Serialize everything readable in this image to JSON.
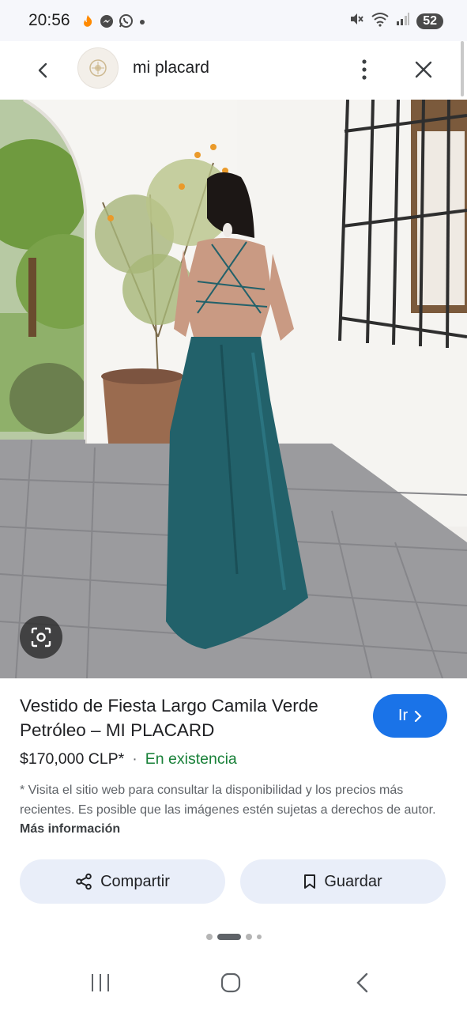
{
  "status_bar": {
    "time": "20:56",
    "battery": "52",
    "left_icons": [
      "fire-icon",
      "messenger-icon",
      "whatsapp-icon",
      "dot-icon"
    ],
    "right_icons": [
      "mute-icon",
      "wifi-icon",
      "signal-icon"
    ]
  },
  "header": {
    "site_name": "mi placard",
    "icons": [
      "back-arrow-icon",
      "site-logo",
      "more-vert-icon",
      "close-icon"
    ]
  },
  "product": {
    "title": "Vestido de Fiesta Largo Camila Verde Petróleo – MI PLACARD",
    "price": "$170,000 CLP*",
    "separator": "·",
    "stock": "En existencia",
    "disclaimer": "* Visita el sitio web para consultar la disponibilidad y los precios más recientes. Es posible que las imágenes estén sujetas a derechos de autor.",
    "more_info": "Más información"
  },
  "buttons": {
    "go": "Ir",
    "share": "Compartir",
    "save": "Guardar"
  },
  "colors": {
    "accent": "#1a73e8",
    "stock_green": "#188038",
    "pill_bg": "#e9eef9",
    "dress_teal": "#22616a"
  },
  "pager": {
    "count": 5,
    "active_index": 1
  }
}
